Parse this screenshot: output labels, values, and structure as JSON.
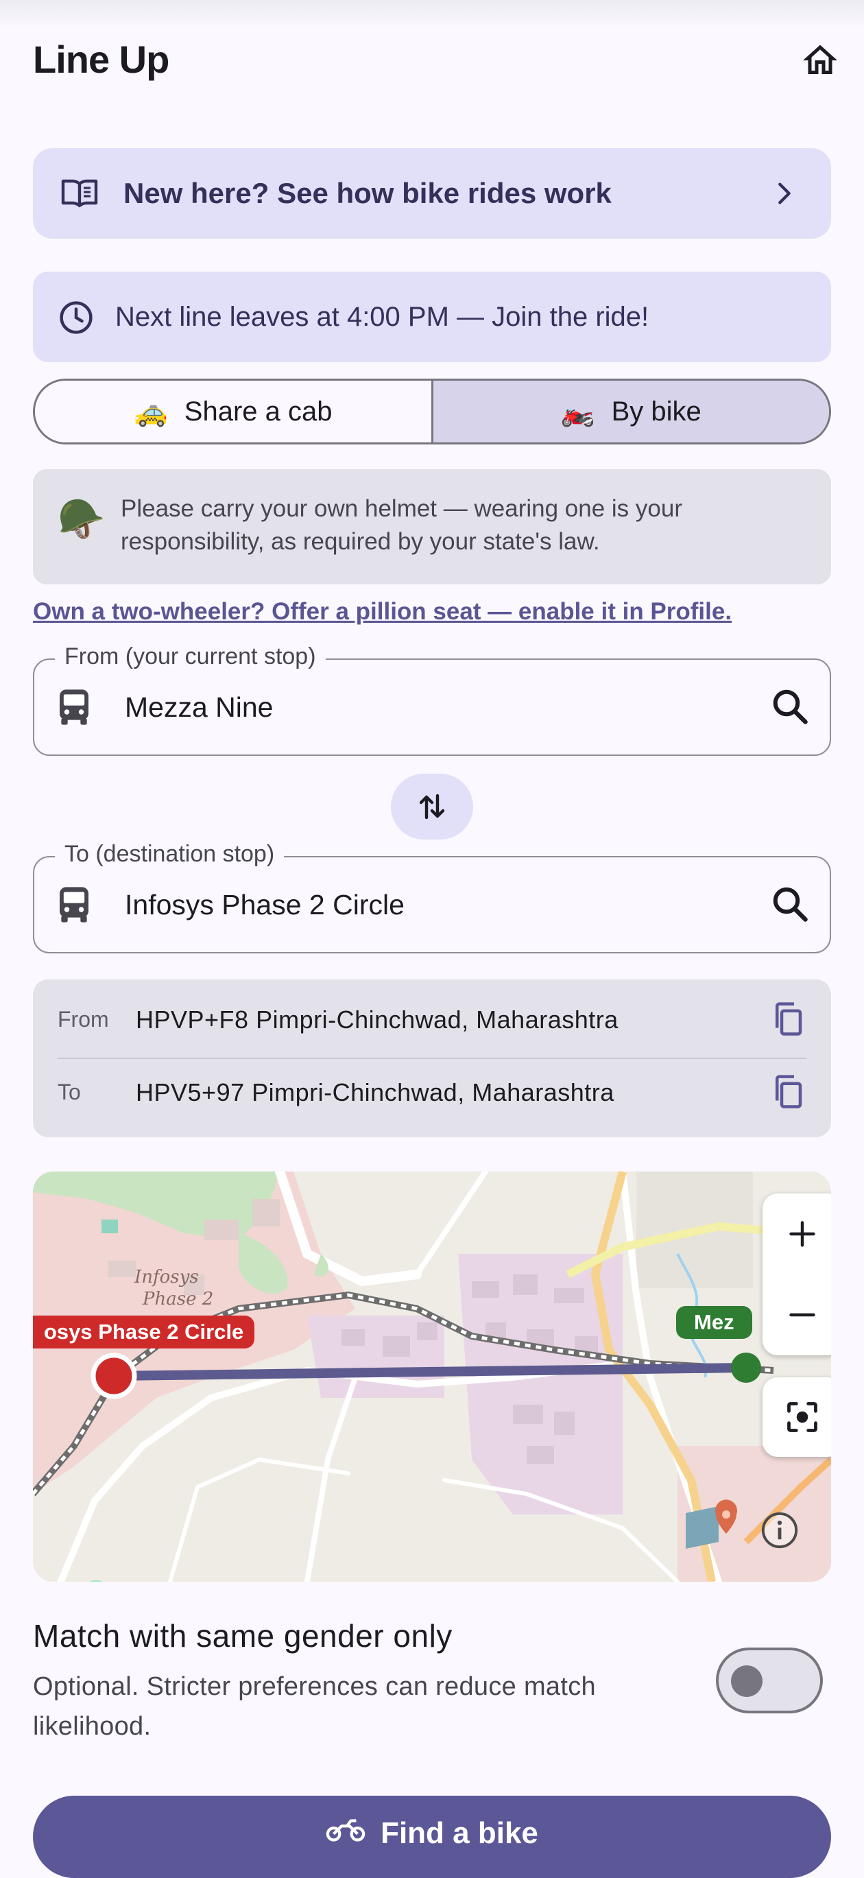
{
  "app": {
    "title": "Line Up"
  },
  "banners": {
    "how_it_works": "New here? See how bike rides work",
    "next_line": "Next line leaves at 4:00 PM — Join the ride!"
  },
  "mode_toggle": {
    "options": [
      {
        "label": "Share a cab",
        "emoji": "🚕",
        "selected": false
      },
      {
        "label": "By bike",
        "emoji": "🏍️",
        "selected": true
      }
    ]
  },
  "helmet_notice": {
    "emoji": "🪖",
    "text": "Please carry your own helmet — wearing one is your responsibility, as required by your state's law."
  },
  "pillion_link": "Own a two-wheeler? Offer a pillion seat — enable it in Profile.",
  "from_field": {
    "label": "From (your current stop)",
    "value": "Mezza Nine"
  },
  "to_field": {
    "label": "To (destination stop)",
    "value": "Infosys Phase 2 Circle"
  },
  "plus_codes": {
    "from_label": "From",
    "from_value": "HPVP+F8 Pimpri-Chinchwad, Maharashtra",
    "to_label": "To",
    "to_value": "HPV5+97 Pimpri-Chinchwad, Maharashtra"
  },
  "map": {
    "destination_pin_label": "osys Phase 2 Circle",
    "origin_pin_label": "Mez",
    "area_label_line1": "Infosys",
    "area_label_line2": "Phase 2",
    "route_color": "#5c5a8e",
    "destination_color": "#cf2a2a",
    "origin_color": "#2e7d32"
  },
  "gender_pref": {
    "title": "Match with same gender only",
    "subtitle": "Optional. Stricter preferences can reduce match likelihood.",
    "enabled": false
  },
  "primary_action": {
    "label": "Find a bike"
  },
  "colors": {
    "accent": "#5c5797",
    "container": "#e2dff8",
    "surface": "#fbf8ff"
  }
}
